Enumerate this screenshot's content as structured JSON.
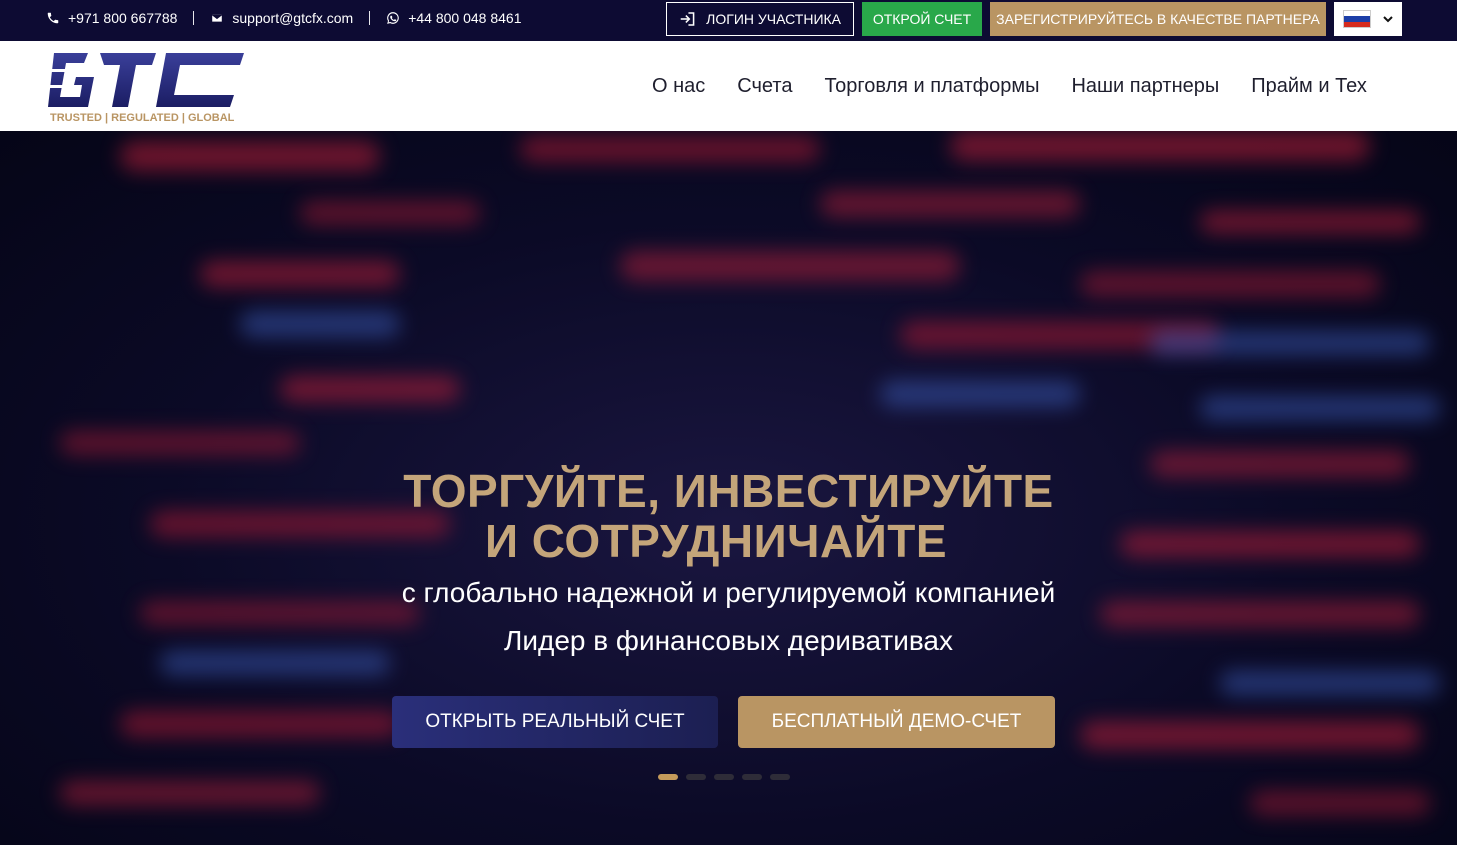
{
  "topbar": {
    "phone": "+971 800 667788",
    "email": "support@gtcfx.com",
    "whatsapp": "+44 800 048 8461",
    "login_label": "ЛОГИН УЧАСТНИКА",
    "open_account_label": "ОТКРОЙ СЧЕТ",
    "partner_label": "ЗАРЕГИСТРИРУЙТЕСЬ В КАЧЕСТВЕ ПАРТНЕРА",
    "language_flag": "russia-flag-icon"
  },
  "logo": {
    "brand": "GTC",
    "tagline": "TRUSTED | REGULATED | GLOBAL"
  },
  "nav": {
    "items": [
      "О нас",
      "Счета",
      "Торговля и платформы",
      "Наши партнеры",
      "Прайм и Тех"
    ]
  },
  "hero": {
    "headline_line1": "ТОРГУЙТЕ, ИНВЕСТИРУЙТЕ",
    "headline_line2": "И СОТРУДНИЧАЙТЕ",
    "subline1": "с глобально надежной и регулируемой компанией",
    "subline2": "Лидер в финансовых деривативах",
    "cta_real": "ОТКРЫТЬ РЕАЛЬНЫЙ СЧЕТ",
    "cta_demo": "БЕСПЛАТНЫЙ ДЕМО-СЧЕТ",
    "slides_total": 5,
    "slide_active": 1
  },
  "colors": {
    "topbar_bg": "#0d0b33",
    "gold": "#b99563",
    "green": "#29a84a",
    "navy": "#2a2f7a"
  }
}
